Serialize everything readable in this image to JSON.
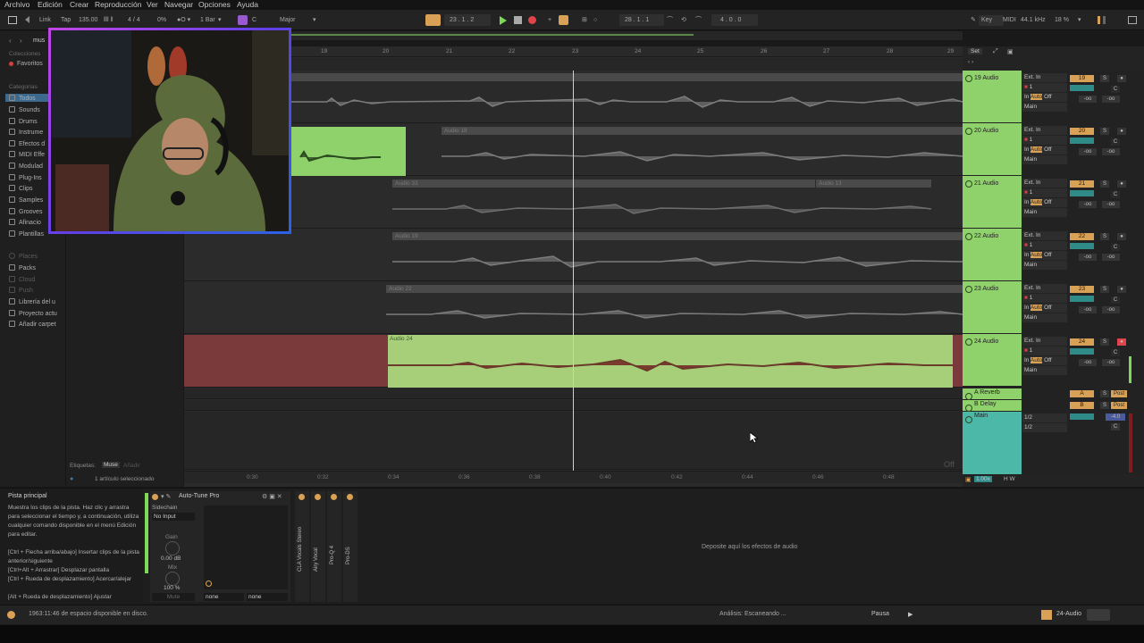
{
  "menu": [
    "Archivo",
    "Edición",
    "Crear",
    "Reproducción",
    "Ver",
    "Navegar",
    "Opciones",
    "Ayuda"
  ],
  "transport": {
    "link": "Link",
    "tap": "Tap",
    "tempo": "135.00",
    "sig": "4 / 4",
    "cpu": "0%",
    "quant": "1 Bar",
    "key": "C",
    "scale": "Major",
    "pos": "23 .  1 .  2",
    "loop_start": "28 .  1 .  1",
    "loop_len": "4 .  0 .  0",
    "key_label": "Key",
    "midi": "MIDI",
    "rate": "44.1 kHz",
    "load": "18 %"
  },
  "browser": {
    "collections": "Colecciones",
    "favorites": "Favoritos",
    "categories": "Categorías",
    "items": [
      "Todos",
      "Sounds",
      "Drums",
      "Instrume",
      "Efectos d",
      "MIDI Effe",
      "Modulad",
      "Plug-Ins",
      "Clips",
      "Samples",
      "Grooves",
      "Afinacio",
      "Plantillas"
    ],
    "places": "Places",
    "place_items": [
      "Packs",
      "Cloud",
      "Push",
      "Librería del u",
      "Proyecto actu",
      "Añadir carpet"
    ],
    "tags_label": "Etiquetas:",
    "tags_value": "Muse",
    "tags_dim": "Añadir",
    "selected": "1 artículo seleccionado",
    "top_tab": "mus"
  },
  "ruler": {
    "bars": [
      "19",
      "20",
      "21",
      "22",
      "23",
      "24",
      "25",
      "26",
      "27",
      "28",
      "29"
    ],
    "times": [
      "0:30",
      "0:32",
      "0:34",
      "0:36",
      "0:38",
      "0:40",
      "0:42",
      "0:44",
      "0:46",
      "0:48"
    ],
    "set": "Set"
  },
  "clips": {
    "c18": "Audio 18",
    "c33": "Audio 33",
    "c13": "Audio 13",
    "c19": "Audio 19",
    "c22": "Audio 22",
    "c24": "Audio 24"
  },
  "tracks": [
    {
      "name": "19 Audio",
      "num": "19"
    },
    {
      "name": "20 Audio",
      "num": "20"
    },
    {
      "name": "21 Audio",
      "num": "21"
    },
    {
      "name": "22 Audio",
      "num": "22"
    },
    {
      "name": "23 Audio",
      "num": "23"
    },
    {
      "name": "24 Audio",
      "num": "24"
    }
  ],
  "io": {
    "ext": "Ext. In",
    "ch": "1",
    "in": "In",
    "auto": "Auto",
    "off": "Off",
    "main": "Main",
    "inf": "-oo",
    "s": "S",
    "c": "C"
  },
  "returns": [
    {
      "name": "A Reverb",
      "letter": "A",
      "post": "Post"
    },
    {
      "name": "B Delay",
      "letter": "B",
      "post": "Post"
    }
  ],
  "main": {
    "name": "Main",
    "r1": "1/2",
    "r2": "1/2",
    "db": "-4.0",
    "c": "C"
  },
  "arr_off": "Off",
  "zoom": "1.00x",
  "hw": "H  W",
  "info": {
    "title": "Pista principal",
    "body": "Muestra los clips de la pista. Haz clic y arrastra para seleccionar el tiempo y, a continuación, utiliza cualquier comando disponible en el menú Edición para editar.",
    "k1": "[Ctrl + Flecha arriba/abajo] Insertar clips de la pista anterior/siguiente",
    "k2": "[Ctrl+Alt + Arrastrar] Desplazar pantalla",
    "k3": "[Ctrl + Rueda de desplazamiento] Acercar/alejar",
    "k4": "[Alt + Rueda de desplazamiento] Ajustar"
  },
  "device": {
    "name": "Auto-Tune Pro",
    "sidechain": "Sidechain",
    "no_input": "No Input",
    "gain": "Gain",
    "gain_val": "0.00 dB",
    "mix": "Mix",
    "mix_val": "100 %",
    "mute": "Mute",
    "none1": "none",
    "none2": "none"
  },
  "chain": [
    "CLA Vocals Stereo",
    "Airy Vocal",
    "Pro-Q 4",
    "Pro-DS"
  ],
  "drop": "Deposite aquí los efectos de audio",
  "status": {
    "disk": "1963:11:46 de espacio disponible en disco.",
    "analysis": "Análisis: Escaneando ...",
    "pause": "Pausa",
    "track": "24-Audio"
  },
  "colors": {
    "green": "#8fd16a",
    "clip24": "#a7cf7a",
    "red": "#7a3a3c",
    "teal": "#2e8b88",
    "orange": "#d9a155"
  }
}
